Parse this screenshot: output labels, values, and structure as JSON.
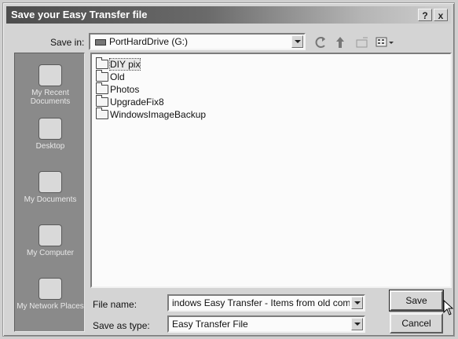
{
  "window": {
    "title": "Save your Easy Transfer file",
    "help_label": "?",
    "close_label": "x"
  },
  "save_in": {
    "label": "Save in:",
    "value": "PortHardDrive (G:)"
  },
  "places": [
    {
      "label": "My Recent Documents",
      "icon": "recent-documents-icon"
    },
    {
      "label": "Desktop",
      "icon": "desktop-icon"
    },
    {
      "label": "My Documents",
      "icon": "my-documents-icon"
    },
    {
      "label": "My Computer",
      "icon": "my-computer-icon"
    },
    {
      "label": "My Network Places",
      "icon": "network-places-icon"
    }
  ],
  "folders": [
    {
      "name": "DIY pix"
    },
    {
      "name": "Old"
    },
    {
      "name": "Photos"
    },
    {
      "name": "UpgradeFix8"
    },
    {
      "name": "WindowsImageBackup"
    }
  ],
  "file_name": {
    "label": "File name:",
    "value": "indows Easy Transfer - Items from old computer"
  },
  "save_as_type": {
    "label": "Save as type:",
    "value": "Easy Transfer File"
  },
  "buttons": {
    "save": "Save",
    "cancel": "Cancel"
  }
}
